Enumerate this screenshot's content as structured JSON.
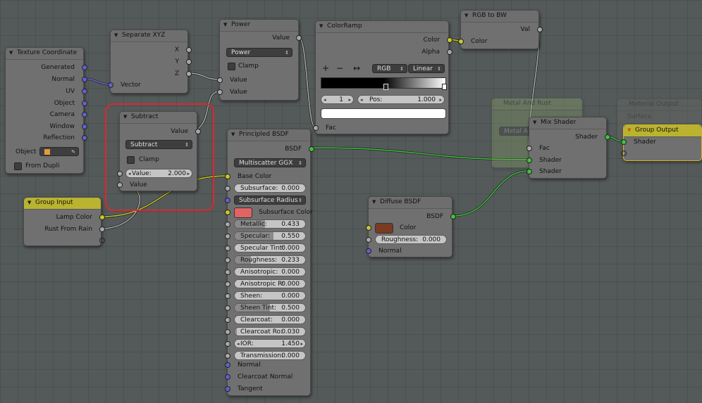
{
  "nodes": {
    "texcoord": {
      "title": "Texture Coordinate",
      "outputs": [
        "Generated",
        "Normal",
        "UV",
        "Object",
        "Camera",
        "Window",
        "Reflection"
      ],
      "object_label": "Object",
      "from_dupli": "From Dupli"
    },
    "sepxyz": {
      "title": "Separate XYZ",
      "outputs": [
        "X",
        "Y",
        "Z"
      ],
      "input": "Vector"
    },
    "power": {
      "title": "Power",
      "output": "Value",
      "operation": "Power",
      "clamp": "Clamp",
      "inputs": [
        "Value",
        "Value"
      ]
    },
    "colorramp": {
      "title": "ColorRamp",
      "outputs": [
        "Color",
        "Alpha"
      ],
      "add": "+",
      "remove": "−",
      "flip": "↔",
      "mode": "RGB",
      "interp": "Linear",
      "index": "1",
      "pos_label": "Pos:",
      "pos_value": "1.000",
      "input": "Fac"
    },
    "rgbtobw": {
      "title": "RGB to BW",
      "output": "Val",
      "input": "Color"
    },
    "subtract": {
      "title": "Subtract",
      "output": "Value",
      "operation": "Subtract",
      "clamp": "Clamp",
      "value_label": "Value:",
      "value": "2.000",
      "input": "Value"
    },
    "groupinput": {
      "title": "Group Input",
      "outputs": [
        "Lamp Color",
        "Rust From Rain"
      ]
    },
    "principled": {
      "title": "Principled BSDF",
      "output": "BSDF",
      "distribution": "Multiscatter GGX",
      "base_color": "Base Color",
      "subsurface_label": "Subsurface:",
      "subsurface": "0.000",
      "subsurface_radius": "Subsurface Radius",
      "subsurface_color": "Subsurface Color",
      "fields": [
        {
          "label": "Metallic:",
          "value": "0.433",
          "fill": 0.433
        },
        {
          "label": "Specular:",
          "value": "0.550",
          "fill": 0.55
        },
        {
          "label": "Specular Tint:",
          "value": "0.000",
          "fill": 0.0
        },
        {
          "label": "Roughness:",
          "value": "0.233",
          "fill": 0.233
        },
        {
          "label": "Anisotropic:",
          "value": "0.000",
          "fill": 0.0
        },
        {
          "label": "Anisotropic R:",
          "value": "0.000",
          "fill": 0.0
        },
        {
          "label": "Sheen:",
          "value": "0.000",
          "fill": 0.0
        },
        {
          "label": "Sheen Tint:",
          "value": "0.500",
          "fill": 0.5
        },
        {
          "label": "Clearcoat:",
          "value": "0.000",
          "fill": 0.0
        },
        {
          "label": "Clearcoat Ro:",
          "value": "0.030",
          "fill": 0.03
        },
        {
          "label": "IOR:",
          "value": "1.450",
          "fill": 0.0
        },
        {
          "label": "Transmission:",
          "value": "0.000",
          "fill": 0.0
        }
      ],
      "normal": "Normal",
      "clearcoat_normal": "Clearcoat Normal",
      "tangent": "Tangent"
    },
    "diffuse": {
      "title": "Diffuse BSDF",
      "output": "BSDF",
      "color": "Color",
      "roughness_label": "Roughness:",
      "roughness": "0.000",
      "normal": "Normal"
    },
    "mixshader": {
      "title": "Mix Shader",
      "output": "Shader",
      "inputs": [
        "Fac",
        "Shader",
        "Shader"
      ]
    },
    "groupoutput": {
      "title": "Group Output",
      "input": "Shader"
    },
    "ghost_metal": {
      "title": "Metal And Rust",
      "field": "Metal An"
    },
    "ghost_material": {
      "title": "Material Output",
      "input": "Surface"
    }
  },
  "colors": {
    "subsurface_swatch": "#e06464",
    "diffuse_swatch": "#7a3a22",
    "selection": "#e0252f"
  }
}
